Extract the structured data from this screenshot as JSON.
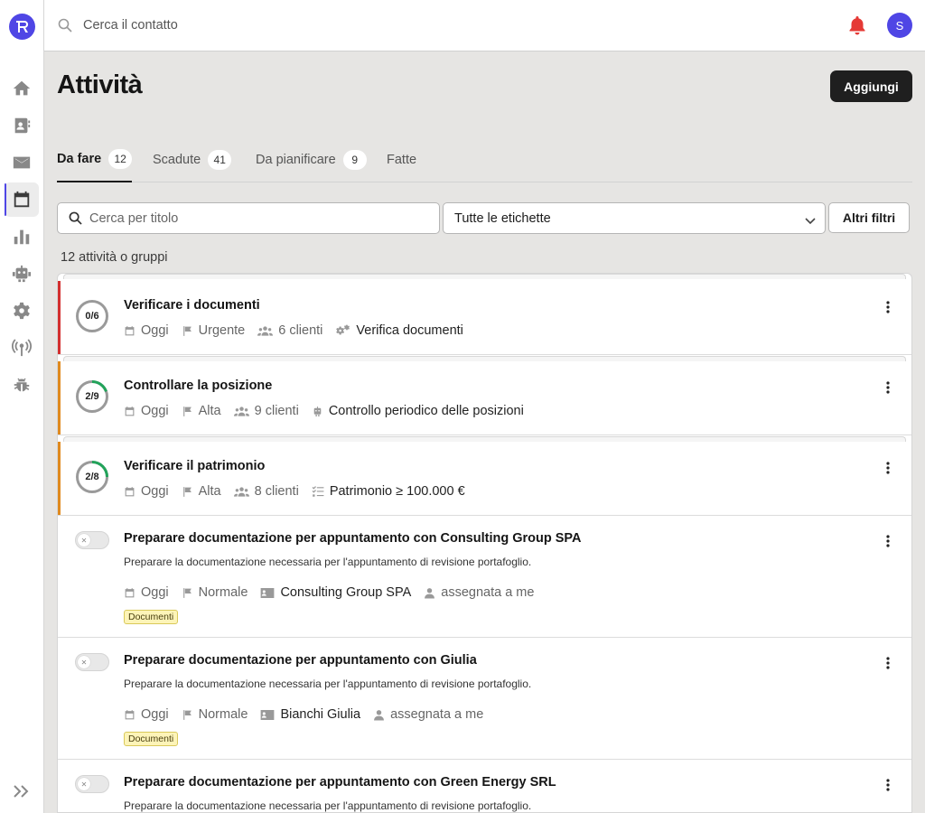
{
  "topbar": {
    "search_placeholder": "Cerca il contatto",
    "avatar_initial": "S"
  },
  "page": {
    "title": "Attività",
    "add_button": "Aggiungi"
  },
  "tabs": [
    {
      "label": "Da fare",
      "count": "12"
    },
    {
      "label": "Scadute",
      "count": "41"
    },
    {
      "label": "Da pianificare",
      "count": "9"
    },
    {
      "label": "Fatte"
    }
  ],
  "filters": {
    "search_placeholder": "Cerca per titolo",
    "labels_select": "Tutte le etichette",
    "more_filters": "Altri filtri"
  },
  "list_count": "12 attività o gruppi",
  "groups": [
    {
      "progress": "0/6",
      "title": "Verificare i documenti",
      "date": "Oggi",
      "priority": "Urgente",
      "clients": "6 clienti",
      "type": "Verifica documenti",
      "accent": "#d32f2f"
    },
    {
      "progress": "2/9",
      "title": "Controllare la posizione",
      "date": "Oggi",
      "priority": "Alta",
      "clients": "9 clienti",
      "type": "Controllo periodico delle posizioni",
      "accent": "#e08a1e"
    },
    {
      "progress": "2/8",
      "title": "Verificare il patrimonio",
      "date": "Oggi",
      "priority": "Alta",
      "clients": "8 clienti",
      "type": "Patrimonio ≥ 100.000 €",
      "accent": "#e08a1e"
    }
  ],
  "tasks": [
    {
      "title": "Preparare documentazione per appuntamento con Consulting Group SPA",
      "description": "Preparare la documentazione necessaria per l'appuntamento di revisione portafoglio.",
      "date": "Oggi",
      "priority": "Normale",
      "contact": "Consulting Group SPA",
      "assignee": "assegnata a me",
      "tag": "Documenti"
    },
    {
      "title": "Preparare documentazione per appuntamento con Giulia",
      "description": "Preparare la documentazione necessaria per l'appuntamento di revisione portafoglio.",
      "date": "Oggi",
      "priority": "Normale",
      "contact": "Bianchi Giulia",
      "assignee": "assegnata a me",
      "tag": "Documenti"
    },
    {
      "title": "Preparare documentazione per appuntamento con Green Energy SRL",
      "description": "Preparare la documentazione necessaria per l'appuntamento di revisione portafoglio."
    }
  ],
  "colors": {
    "accent": "#4f46e5",
    "urgent": "#d32f2f",
    "high": "#e08a1e",
    "progress": "#22a35a",
    "bell": "#e53935"
  }
}
